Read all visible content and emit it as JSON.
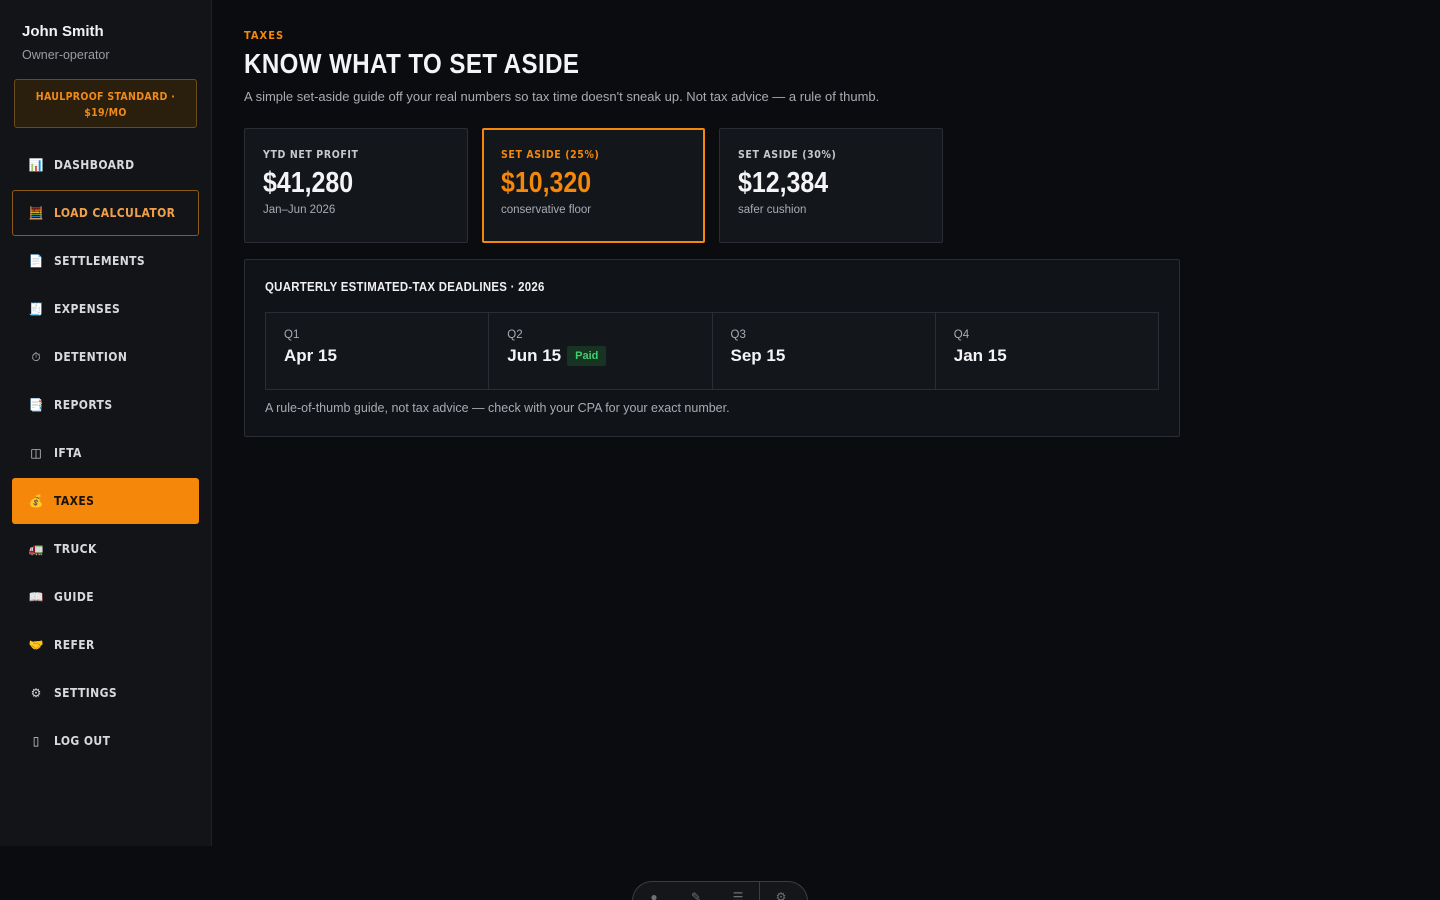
{
  "user": {
    "name": "John Smith",
    "role": "Owner-operator"
  },
  "plan": {
    "label": "HAULPROOF STANDARD · $19/MO"
  },
  "nav": [
    {
      "label": "DASHBOARD",
      "icon": "📊",
      "icon_name": "bar-chart-icon"
    },
    {
      "label": "LOAD CALCULATOR",
      "icon": "🧮",
      "icon_name": "calculator-icon"
    },
    {
      "label": "SETTLEMENTS",
      "icon": "📄",
      "icon_name": "document-icon"
    },
    {
      "label": "EXPENSES",
      "icon": "🧾",
      "icon_name": "receipt-icon"
    },
    {
      "label": "DETENTION",
      "icon": "⏱",
      "icon_name": "stopwatch-icon"
    },
    {
      "label": "REPORTS",
      "icon": "📑",
      "icon_name": "report-icon"
    },
    {
      "label": "IFTA",
      "icon": "◫",
      "icon_name": "columns-icon"
    },
    {
      "label": "TAXES",
      "icon": "💰",
      "icon_name": "money-bag-icon"
    },
    {
      "label": "TRUCK",
      "icon": "🚛",
      "icon_name": "truck-icon"
    },
    {
      "label": "GUIDE",
      "icon": "📖",
      "icon_name": "book-icon"
    },
    {
      "label": "REFER",
      "icon": "🤝",
      "icon_name": "handshake-icon"
    },
    {
      "label": "SETTINGS",
      "icon": "⚙",
      "icon_name": "gear-icon"
    },
    {
      "label": "LOG OUT",
      "icon": "▯",
      "icon_name": "logout-icon"
    }
  ],
  "page": {
    "eyebrow": "TAXES",
    "title": "KNOW WHAT TO SET ASIDE",
    "subtitle": "A simple set-aside guide off your real numbers so tax time doesn't sneak up. Not tax advice — a rule of thumb."
  },
  "stats": [
    {
      "label": "YTD NET PROFIT",
      "value": "$41,280",
      "note": "Jan–Jun 2026"
    },
    {
      "label": "SET ASIDE (25%)",
      "value": "$10,320",
      "note": "conservative floor"
    },
    {
      "label": "SET ASIDE (30%)",
      "value": "$12,384",
      "note": "safer cushion"
    }
  ],
  "deadlines": {
    "title": "QUARTERLY ESTIMATED-TAX DEADLINES · 2026",
    "quarters": [
      {
        "label": "Q1",
        "date": "Apr 15",
        "status": ""
      },
      {
        "label": "Q2",
        "date": "Jun 15",
        "status": "Paid"
      },
      {
        "label": "Q3",
        "date": "Sep 15",
        "status": ""
      },
      {
        "label": "Q4",
        "date": "Jan 15",
        "status": ""
      }
    ],
    "disclaimer": "A rule-of-thumb guide, not tax advice — check with your CPA for your exact number."
  },
  "colors": {
    "accent": "#f5870a",
    "background": "#0a0c10",
    "sidebar": "#121418",
    "paid": "#3fcf6e"
  }
}
